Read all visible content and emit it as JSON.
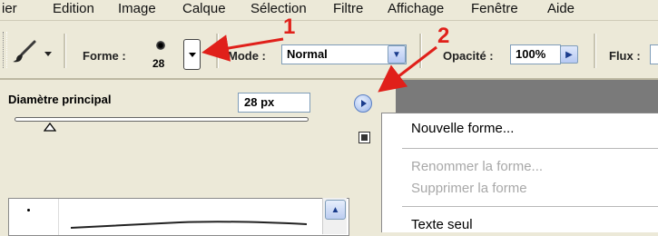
{
  "menubar": {
    "items": [
      "ier",
      "Edition",
      "Image",
      "Calque",
      "Sélection",
      "Filtre",
      "Affichage",
      "Fenêtre",
      "Aide"
    ]
  },
  "options": {
    "forme_label": "Forme :",
    "brush_size": "28",
    "mode_label": "Mode :",
    "mode_value": "Normal",
    "opacite_label": "Opacité :",
    "opacite_value": "100%",
    "flux_label": "Flux :"
  },
  "panel": {
    "diametre_label": "Diamètre principal",
    "diametre_value": "28 px",
    "diametre_fraction": 0.12
  },
  "flyout": {
    "items": [
      {
        "label": "Nouvelle forme...",
        "enabled": true
      },
      {
        "label": "Renommer la forme...",
        "enabled": false
      },
      {
        "label": "Supprimer la forme",
        "enabled": false
      },
      {
        "label": "Texte seul",
        "enabled": true
      }
    ]
  },
  "annotations": {
    "marker_1": "1",
    "marker_2": "2",
    "arrow_color": "#e0201a"
  },
  "icons": {
    "brush_tool": "brush-icon",
    "brush_preview": "brush-tip-icon",
    "panel_menu": "play-circle-icon",
    "new_preset": "new-preset-icon",
    "scroll_up": "chevron-up-icon"
  }
}
